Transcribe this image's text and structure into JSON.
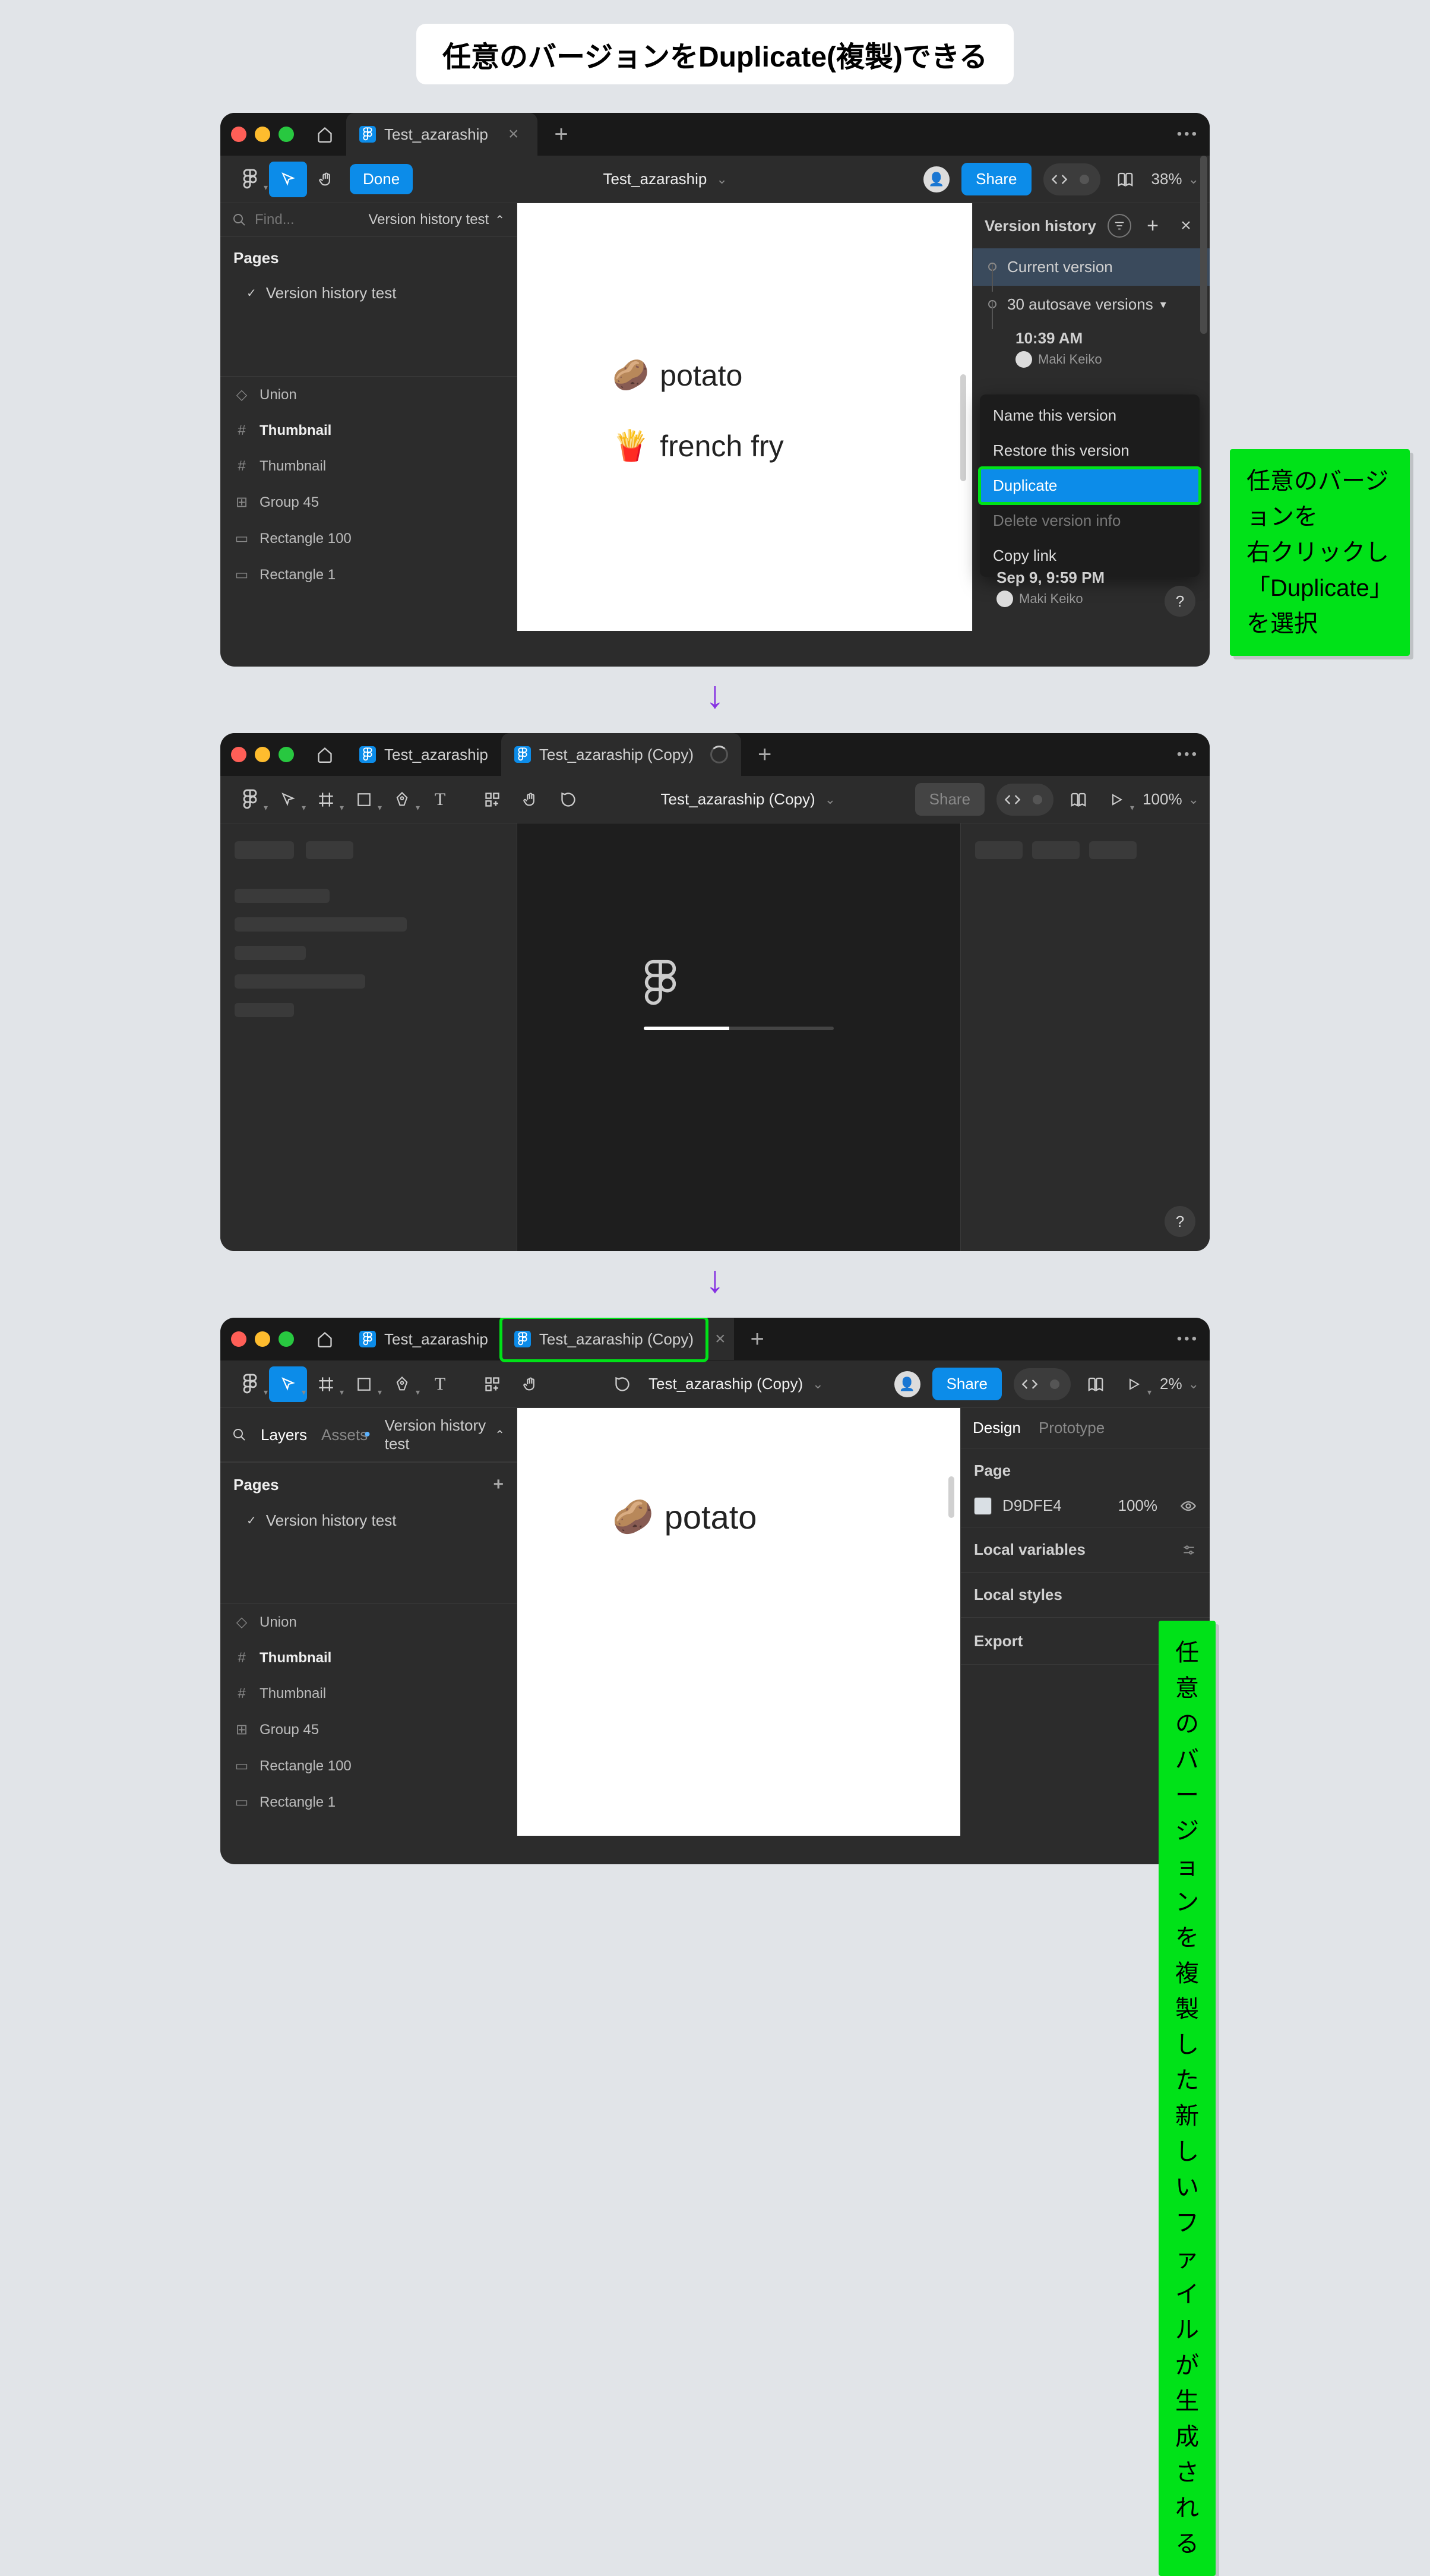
{
  "banner": "任意のバージョンをDuplicate(複製)できる",
  "w1": {
    "tab_title": "Test_azaraship",
    "done": "Done",
    "title": "Test_azaraship",
    "share": "Share",
    "zoom": "38%",
    "find_placeholder": "Find...",
    "vh_toggle": "Version history test",
    "pages": "Pages",
    "page_item": "Version history test",
    "layers": [
      "Union",
      "Thumbnail",
      "Thumbnail",
      "Group 45",
      "Rectangle 100",
      "Rectangle 1"
    ],
    "vh": {
      "title": "Version history",
      "current": "Current version",
      "autosave": "30 autosave versions",
      "entry_time": "10:39 AM",
      "entry_author": "Maki Keiko",
      "entry2_time": "Sep 9, 9:59 PM",
      "entry2_author": "Maki Keiko"
    },
    "ctx": {
      "name": "Name this version",
      "restore": "Restore this version",
      "duplicate": "Duplicate",
      "delete": "Delete version info",
      "copy": "Copy link"
    },
    "canvas": {
      "l1": "potato",
      "l2": "french fry"
    }
  },
  "callout1": "任意のバージョンを\n右クリックし\n「Duplicate」を選択",
  "w2": {
    "tab1": "Test_azaraship",
    "tab2": "Test_azaraship (Copy)",
    "title": "Test_azaraship (Copy)",
    "share": "Share",
    "zoom": "100%"
  },
  "w3": {
    "tab1": "Test_azaraship",
    "tab2": "Test_azaraship (Copy)",
    "title": "Test_azaraship (Copy)",
    "share": "Share",
    "zoom": "2%",
    "layers_tab": "Layers",
    "assets_tab": "Assets",
    "vh_toggle": "Version history test",
    "pages": "Pages",
    "page_item": "Version history test",
    "layers": [
      "Union",
      "Thumbnail",
      "Thumbnail",
      "Group 45",
      "Rectangle 100",
      "Rectangle 1"
    ],
    "design": {
      "tab_design": "Design",
      "tab_proto": "Prototype",
      "page": "Page",
      "color": "D9DFE4",
      "pct": "100%",
      "locals": "Local variables",
      "styles": "Local styles",
      "export": "Export"
    },
    "canvas": {
      "l1": "potato"
    }
  },
  "callout2": "任意のバージョンを\n複製した新しいファイルが\n生成される"
}
